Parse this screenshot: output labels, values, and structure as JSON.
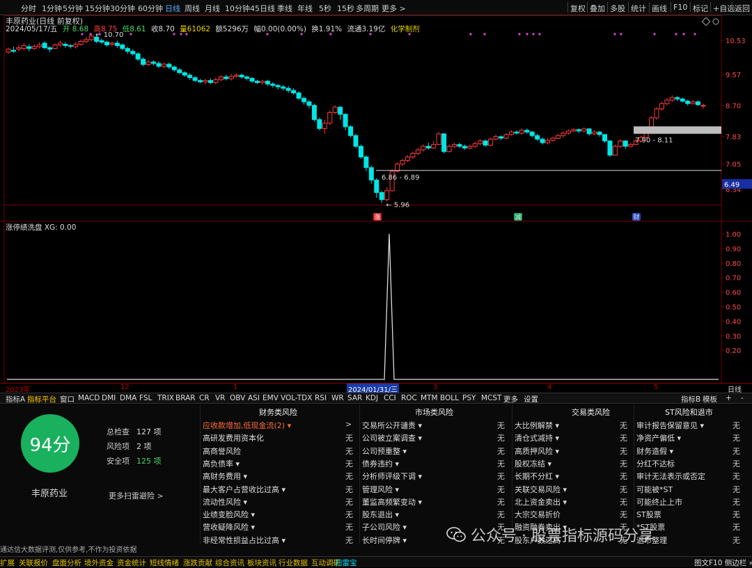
{
  "period_bar": {
    "periods": [
      "分时",
      "1分钟",
      "5分钟",
      "15分钟",
      "30分钟",
      "60分钟",
      "日线",
      "周线",
      "月线",
      "10分钟",
      "45日线",
      "季线",
      "年线",
      "5秒",
      "15秒",
      "多周期",
      "更多 >"
    ],
    "active": "日线",
    "tools": [
      "复权",
      "叠加",
      "多股",
      "统计",
      "画线",
      "F10",
      "标记",
      "+自选",
      "返回"
    ]
  },
  "chart": {
    "title": "丰原药业(日线 前复权)",
    "quote": {
      "date": "2024/05/17/五",
      "open": "开 8.68",
      "high": "高8.75",
      "low": "低8.61",
      "close": "收8.70",
      "volume": "量61062",
      "amount": "额5296万",
      "change": "幅0.00(0.00%)",
      "turnover": "换1.91%",
      "float": "流通3.19亿",
      "sector": "化学制剂"
    },
    "price_axis": [
      "10.53",
      "9.57",
      "8.70",
      "7.83",
      "7.05",
      "6.34"
    ],
    "current_price_tag": "6.49",
    "max_label": "10.70",
    "min_label": "5.96",
    "zone_label_1": "6.86 - 6.89",
    "zone_label_2": "7.90 - 8.11",
    "markers": [
      "涨",
      "减",
      "财"
    ],
    "candles": [
      [
        10.2,
        10.28,
        10.32,
        10.15
      ],
      [
        10.25,
        10.22,
        10.35,
        10.18
      ],
      [
        10.28,
        10.32,
        10.4,
        10.22
      ],
      [
        10.3,
        10.38,
        10.45,
        10.25
      ],
      [
        10.35,
        10.3,
        10.42,
        10.22
      ],
      [
        10.3,
        10.36,
        10.42,
        10.26
      ],
      [
        10.35,
        10.4,
        10.48,
        10.3
      ],
      [
        10.45,
        10.32,
        10.5,
        10.28
      ],
      [
        10.32,
        10.28,
        10.36,
        10.2
      ],
      [
        10.3,
        10.4,
        10.44,
        10.28
      ],
      [
        10.4,
        10.45,
        10.52,
        10.35
      ],
      [
        10.42,
        10.38,
        10.48,
        10.32
      ],
      [
        10.38,
        10.36,
        10.42,
        10.3
      ],
      [
        10.35,
        10.42,
        10.48,
        10.3
      ],
      [
        10.42,
        10.5,
        10.55,
        10.38
      ],
      [
        10.5,
        10.55,
        10.62,
        10.45
      ],
      [
        10.55,
        10.65,
        10.7,
        10.5
      ],
      [
        10.62,
        10.5,
        10.66,
        10.45
      ],
      [
        10.52,
        10.48,
        10.58,
        10.42
      ],
      [
        10.48,
        10.4,
        10.52,
        10.35
      ],
      [
        10.42,
        10.45,
        10.5,
        10.36
      ],
      [
        10.45,
        10.38,
        10.52,
        10.32
      ],
      [
        10.4,
        10.3,
        10.44,
        10.25
      ],
      [
        10.3,
        10.22,
        10.35,
        10.15
      ],
      [
        10.22,
        10.15,
        10.28,
        10.1
      ],
      [
        10.15,
        10.0,
        10.2,
        9.95
      ],
      [
        10.0,
        9.85,
        10.05,
        9.8
      ],
      [
        9.85,
        9.92,
        9.98,
        9.8
      ],
      [
        9.92,
        9.88,
        9.96,
        9.82
      ],
      [
        9.88,
        9.8,
        9.94,
        9.75
      ],
      [
        9.8,
        9.86,
        9.9,
        9.74
      ],
      [
        9.86,
        9.78,
        9.9,
        9.72
      ],
      [
        9.78,
        9.7,
        9.82,
        9.65
      ],
      [
        9.7,
        9.62,
        9.75,
        9.58
      ],
      [
        9.62,
        9.55,
        9.66,
        9.5
      ],
      [
        9.55,
        9.48,
        9.6,
        9.42
      ],
      [
        9.48,
        9.4,
        9.52,
        9.36
      ],
      [
        9.4,
        9.36,
        9.45,
        9.32
      ],
      [
        9.36,
        9.4,
        9.44,
        9.3
      ],
      [
        9.4,
        9.34,
        9.46,
        9.3
      ],
      [
        9.34,
        9.42,
        9.48,
        9.3
      ],
      [
        9.42,
        9.5,
        9.55,
        9.38
      ],
      [
        9.5,
        9.45,
        9.56,
        9.4
      ],
      [
        9.45,
        9.52,
        9.58,
        9.4
      ],
      [
        9.52,
        9.55,
        9.6,
        9.48
      ],
      [
        9.55,
        9.5,
        9.6,
        9.45
      ],
      [
        9.5,
        9.46,
        9.54,
        9.4
      ],
      [
        9.46,
        9.38,
        9.5,
        9.33
      ],
      [
        9.38,
        9.34,
        9.42,
        9.3
      ],
      [
        9.34,
        9.38,
        9.42,
        9.28
      ],
      [
        9.38,
        9.3,
        9.42,
        9.25
      ],
      [
        9.3,
        9.26,
        9.35,
        9.2
      ],
      [
        9.26,
        9.22,
        9.3,
        9.15
      ],
      [
        9.22,
        9.18,
        9.28,
        9.12
      ],
      [
        9.18,
        9.12,
        9.24,
        9.06
      ],
      [
        9.12,
        9.05,
        9.18,
        9.0
      ],
      [
        9.05,
        8.9,
        9.1,
        8.85
      ],
      [
        8.9,
        8.8,
        8.95,
        8.72
      ],
      [
        8.8,
        8.7,
        8.85,
        8.62
      ],
      [
        8.7,
        8.3,
        8.75,
        8.25
      ],
      [
        8.3,
        8.05,
        8.35,
        8.0
      ],
      [
        8.05,
        8.2,
        8.3,
        7.9
      ],
      [
        8.2,
        8.5,
        8.55,
        8.15
      ],
      [
        8.5,
        8.65,
        8.7,
        8.45
      ],
      [
        8.65,
        8.45,
        8.68,
        8.3
      ],
      [
        8.45,
        8.1,
        8.48,
        8.0
      ],
      [
        8.1,
        7.85,
        8.15,
        7.8
      ],
      [
        7.85,
        7.55,
        7.9,
        7.5
      ],
      [
        7.55,
        7.25,
        7.6,
        7.2
      ],
      [
        7.25,
        6.95,
        7.3,
        6.85
      ],
      [
        6.95,
        6.6,
        7.0,
        6.5
      ],
      [
        6.6,
        6.25,
        6.65,
        6.1
      ],
      [
        6.25,
        6.05,
        6.3,
        5.96
      ],
      [
        6.05,
        6.3,
        6.4,
        6.0
      ],
      [
        6.3,
        6.85,
        6.9,
        6.28
      ],
      [
        6.85,
        7.05,
        7.1,
        6.82
      ],
      [
        7.05,
        7.15,
        7.2,
        7.0
      ],
      [
        7.15,
        7.25,
        7.3,
        7.1
      ],
      [
        7.25,
        7.35,
        7.4,
        7.2
      ],
      [
        7.35,
        7.45,
        7.5,
        7.3
      ],
      [
        7.45,
        7.55,
        7.6,
        7.4
      ],
      [
        7.55,
        7.5,
        7.65,
        7.45
      ],
      [
        7.5,
        7.6,
        7.7,
        7.48
      ],
      [
        7.6,
        7.9,
        7.95,
        7.58
      ],
      [
        7.9,
        7.4,
        7.92,
        7.35
      ],
      [
        7.4,
        7.55,
        7.6,
        7.38
      ],
      [
        7.55,
        7.6,
        7.65,
        7.5
      ],
      [
        7.6,
        7.55,
        7.65,
        7.5
      ],
      [
        7.55,
        7.5,
        7.6,
        7.45
      ],
      [
        7.5,
        7.55,
        7.6,
        7.46
      ],
      [
        7.55,
        7.62,
        7.68,
        7.5
      ],
      [
        7.62,
        7.7,
        7.75,
        7.58
      ],
      [
        7.7,
        7.58,
        7.74,
        7.54
      ],
      [
        7.58,
        7.75,
        7.8,
        7.55
      ],
      [
        7.75,
        7.82,
        7.88,
        7.72
      ],
      [
        7.82,
        7.78,
        7.86,
        7.72
      ],
      [
        7.78,
        7.88,
        7.92,
        7.75
      ],
      [
        7.88,
        7.95,
        8.0,
        7.85
      ],
      [
        7.95,
        7.92,
        8.0,
        7.88
      ],
      [
        7.92,
        8.0,
        8.05,
        7.88
      ],
      [
        8.0,
        7.95,
        8.05,
        7.9
      ],
      [
        7.95,
        7.85,
        7.98,
        7.8
      ],
      [
        7.85,
        7.75,
        7.9,
        7.7
      ],
      [
        7.75,
        7.65,
        7.8,
        7.6
      ],
      [
        7.65,
        7.72,
        7.78,
        7.6
      ],
      [
        7.72,
        7.78,
        7.82,
        7.68
      ],
      [
        7.78,
        7.85,
        7.9,
        7.75
      ],
      [
        7.85,
        7.92,
        7.96,
        7.8
      ],
      [
        7.92,
        7.98,
        8.02,
        7.88
      ],
      [
        7.98,
        8.02,
        8.06,
        7.95
      ],
      [
        8.02,
        7.98,
        8.05,
        7.92
      ],
      [
        7.98,
        8.04,
        8.08,
        7.94
      ],
      [
        8.04,
        7.9,
        8.06,
        7.85
      ],
      [
        7.9,
        7.95,
        8.0,
        7.86
      ],
      [
        7.95,
        7.88,
        7.98,
        7.82
      ],
      [
        7.88,
        7.7,
        7.9,
        7.65
      ],
      [
        7.7,
        7.3,
        7.72,
        7.25
      ],
      [
        7.3,
        7.55,
        7.6,
        7.28
      ],
      [
        7.55,
        7.7,
        7.75,
        7.5
      ],
      [
        7.7,
        7.55,
        7.72,
        7.48
      ],
      [
        7.55,
        7.6,
        7.65,
        7.52
      ],
      [
        7.6,
        7.7,
        7.75,
        7.58
      ],
      [
        7.7,
        7.8,
        7.85,
        7.68
      ],
      [
        7.8,
        7.95,
        8.0,
        7.78
      ],
      [
        7.95,
        8.35,
        8.4,
        7.9
      ],
      [
        8.35,
        8.6,
        8.65,
        8.3
      ],
      [
        8.6,
        8.75,
        8.8,
        8.55
      ],
      [
        8.75,
        8.85,
        8.9,
        8.7
      ],
      [
        8.85,
        8.92,
        8.98,
        8.8
      ],
      [
        8.92,
        8.88,
        8.96,
        8.82
      ],
      [
        8.88,
        8.82,
        8.92,
        8.78
      ],
      [
        8.82,
        8.75,
        8.86,
        8.7
      ],
      [
        8.75,
        8.8,
        8.85,
        8.72
      ],
      [
        8.8,
        8.72,
        8.84,
        8.68
      ],
      [
        8.68,
        8.7,
        8.75,
        8.61
      ]
    ]
  },
  "indicator": {
    "title": "涨停绩洗盘  XG: 0.00",
    "axis": [
      "1.00",
      "0.90",
      "0.80",
      "0.70",
      "0.60",
      "0.50",
      "0.40",
      "0.30",
      "0.20"
    ],
    "peak_value": 1.0
  },
  "date_axis": {
    "labels": [
      "2023年",
      "12",
      "1",
      "3",
      "4",
      "5"
    ],
    "cursor": "2024/01/31/三",
    "right": "日线"
  },
  "indicator_tabs": {
    "items": [
      "指标A",
      "指标平台",
      "窗口",
      "MACD",
      "DMI",
      "DMA",
      "FSL",
      "TRIX",
      "BRAR",
      "CR",
      "VR",
      "OBV",
      "ASI",
      "EMV",
      "VOL-TDX",
      "RSI",
      "WR",
      "SAR",
      "KDJ",
      "CCI",
      "ROC",
      "MTM",
      "BOLL",
      "PSY",
      "MCST",
      "更多",
      "设置"
    ],
    "active": "指标平台",
    "right": [
      "指标B",
      "模板",
      "+",
      "-"
    ]
  },
  "risk_panel": {
    "score": "94分",
    "company": "丰原药业",
    "total_label": "总检查",
    "total": "127 项",
    "risk_label": "风险项",
    "risk": "2 项",
    "safe_label": "安全项",
    "safe": "125 项",
    "more": "更多扫雷避险 >",
    "disclaimer": "通达信大数据评测,仅供参考,不作为投资依据",
    "columns": [
      {
        "head": "财务类风险",
        "rows": [
          {
            "label": "应收款增加,低现金流(2) ▾",
            "value": ">",
            "alert": true
          },
          {
            "label": "高研发费用资本化",
            "value": "无"
          },
          {
            "label": "高商誉风险",
            "value": "无"
          },
          {
            "label": "高负债率 ▾",
            "value": "无"
          },
          {
            "label": "高财务费用 ▾",
            "value": "无"
          },
          {
            "label": "最大客户占营收比过高 ▾",
            "value": "无"
          },
          {
            "label": "流动性风险 ▾",
            "value": "无"
          },
          {
            "label": "业绩变脸风险 ▾",
            "value": "无"
          },
          {
            "label": "营收疑降风险 ▾",
            "value": "无"
          },
          {
            "label": "非经常性损益占比过高 ▾",
            "value": "无"
          }
        ]
      },
      {
        "head": "市场类风险",
        "rows": [
          {
            "label": "交易所公开谴责 ▾",
            "value": "无"
          },
          {
            "label": "公司被立案调查 ▾",
            "value": "无"
          },
          {
            "label": "公司预重整 ▾",
            "value": "无"
          },
          {
            "label": "债券违约 ▾",
            "value": "无"
          },
          {
            "label": "分析师评级下调 ▾",
            "value": "无"
          },
          {
            "label": "管理风险 ▾",
            "value": "无"
          },
          {
            "label": "董监高频繁变动 ▾",
            "value": "无"
          },
          {
            "label": "股东退出 ▾",
            "value": "无"
          },
          {
            "label": "子公司风险 ▾",
            "value": "无"
          },
          {
            "label": "长时间停牌 ▾",
            "value": "无"
          }
        ]
      },
      {
        "head": "交易类风险",
        "rows": [
          {
            "label": "大比例解禁 ▾",
            "value": "无"
          },
          {
            "label": "清仓式减持 ▾",
            "value": "无"
          },
          {
            "label": "高质押风险 ▾",
            "value": "无"
          },
          {
            "label": "股权冻结 ▾",
            "value": "无"
          },
          {
            "label": "长期不分红 ▾",
            "value": "无"
          },
          {
            "label": "关联交易风险 ▾",
            "value": "无"
          },
          {
            "label": "北上资金卖出 ▾",
            "value": "无"
          },
          {
            "label": "大宗交易折价",
            "value": "无"
          },
          {
            "label": "融资融券卖出 ▾",
            "value": "无"
          },
          {
            "label": "股东户数过高",
            "value": "无"
          }
        ]
      },
      {
        "head": "ST风险和退市",
        "rows": [
          {
            "label": "审计报告保留意见 ▾",
            "value": "无"
          },
          {
            "label": "净资产偏低 ▾",
            "value": "无"
          },
          {
            "label": "财务造假 ▾",
            "value": "无"
          },
          {
            "label": "分红不达标",
            "value": "无"
          },
          {
            "label": "审计无法表示或否定",
            "value": "无"
          },
          {
            "label": "可能被*ST",
            "value": "无"
          },
          {
            "label": "可能终止上市",
            "value": "无"
          },
          {
            "label": "ST股票",
            "value": "无"
          },
          {
            "label": "*ST股票",
            "value": "无"
          },
          {
            "label": "退市整理",
            "value": "无"
          }
        ]
      }
    ]
  },
  "watermark": "公众号 · 股票指标源码分享",
  "status_bar": {
    "items": [
      "扩展",
      "关联报价",
      "盘面分析",
      "境外资金",
      "资金统计",
      "短线情绪",
      "涨跌贡献",
      "综合资讯",
      "板块资讯",
      "行业数据",
      "互动调研",
      "扫雷宝"
    ],
    "active": "扫雷宝",
    "right": "图文F10 侧边栏 »"
  }
}
